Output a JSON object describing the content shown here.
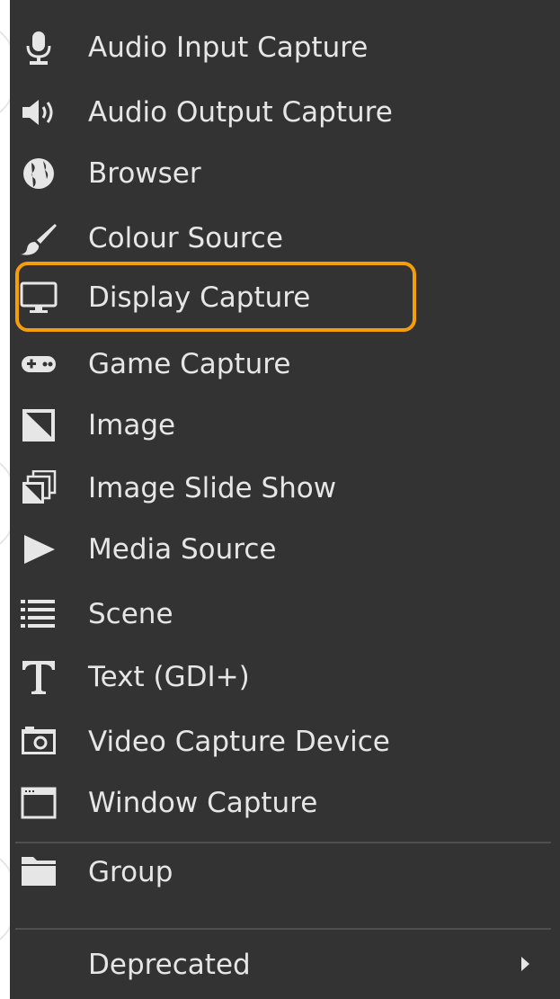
{
  "menu": {
    "items": [
      {
        "label": "Audio Input Capture",
        "icon": "microphone-icon"
      },
      {
        "label": "Audio Output Capture",
        "icon": "speaker-icon"
      },
      {
        "label": "Browser",
        "icon": "globe-icon"
      },
      {
        "label": "Colour Source",
        "icon": "paintbrush-icon"
      },
      {
        "label": "Display Capture",
        "icon": "monitor-icon",
        "highlighted": true
      },
      {
        "label": "Game Capture",
        "icon": "gamepad-icon"
      },
      {
        "label": "Image",
        "icon": "image-icon"
      },
      {
        "label": "Image Slide Show",
        "icon": "image-stack-icon"
      },
      {
        "label": "Media Source",
        "icon": "play-icon"
      },
      {
        "label": "Scene",
        "icon": "list-icon"
      },
      {
        "label": "Text (GDI+)",
        "icon": "text-icon"
      },
      {
        "label": "Video Capture Device",
        "icon": "camera-icon"
      },
      {
        "label": "Window Capture",
        "icon": "window-icon"
      }
    ],
    "group": {
      "label": "Group",
      "icon": "folder-icon"
    },
    "deprecated": {
      "label": "Deprecated",
      "icon": "chevron-right-icon"
    }
  },
  "colors": {
    "menu_background": "#333333",
    "text": "#e6e6e6",
    "highlight": "#f59e0b",
    "separator": "#4f4f4f"
  }
}
